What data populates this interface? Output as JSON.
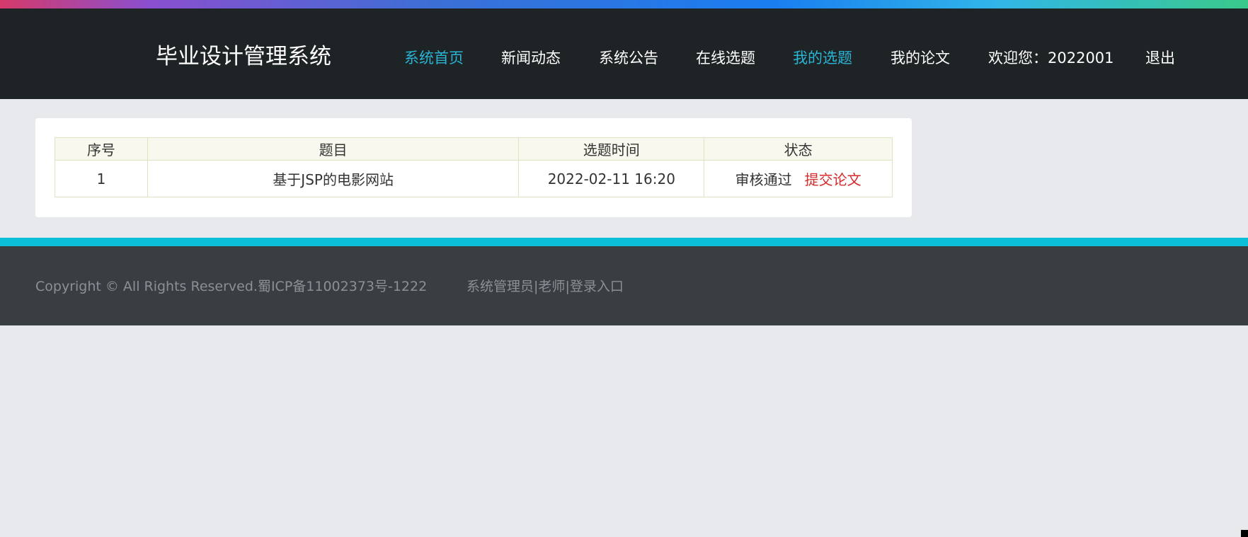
{
  "header": {
    "brand": "毕业设计管理系统",
    "nav": [
      {
        "label": "系统首页",
        "active": true
      },
      {
        "label": "新闻动态",
        "active": false
      },
      {
        "label": "系统公告",
        "active": false
      },
      {
        "label": "在线选题",
        "active": false
      },
      {
        "label": "我的选题",
        "active": true
      },
      {
        "label": "我的论文",
        "active": false
      }
    ],
    "welcome": "欢迎您：2022001",
    "logout": "退出"
  },
  "table": {
    "columns": [
      "序号",
      "题目",
      "选题时间",
      "状态"
    ],
    "rows": [
      {
        "index": "1",
        "title": "基于JSP的电影网站",
        "time": "2022-02-11 16:20",
        "status": "审核通过",
        "action": "提交论文"
      }
    ]
  },
  "footer": {
    "copyright": "Copyright © All Rights Reserved.蜀ICP备11002373号-1222",
    "admin": "系统管理员",
    "sep1": "|",
    "teacher": "老师",
    "sep2": "|",
    "login": "登录入口"
  },
  "colors": {
    "nav_active": "#2ab5d4",
    "action_link": "#d42a2a",
    "footer_accent": "#0bbfd8"
  }
}
